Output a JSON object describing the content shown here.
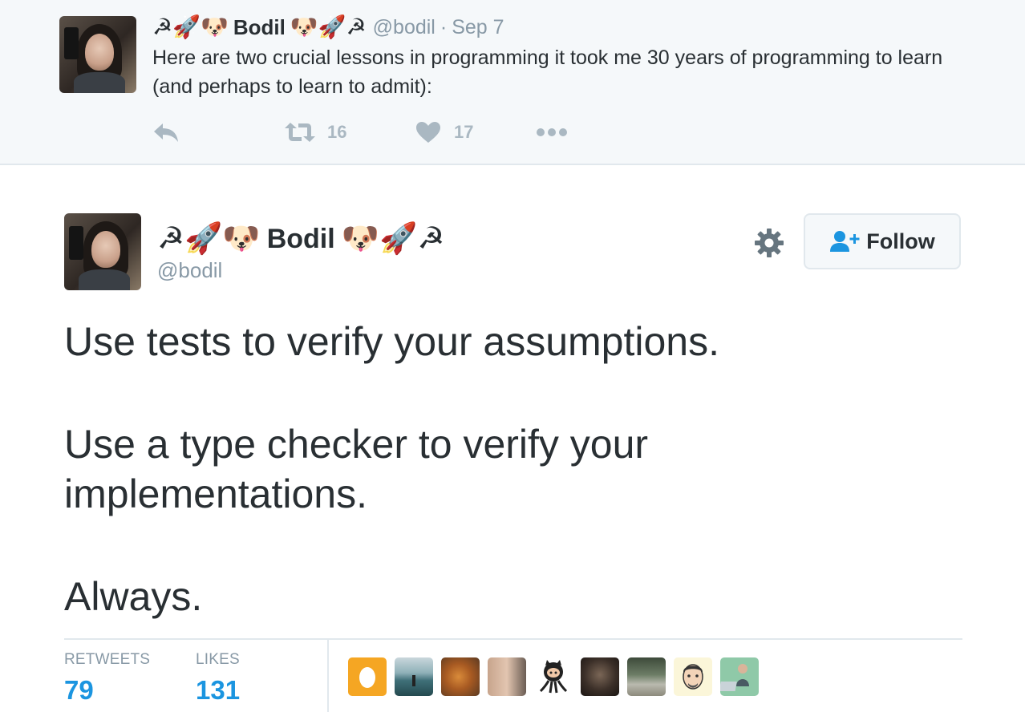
{
  "parent_tweet": {
    "display_name": "Bodil",
    "name_prefix_emoji": "☭🚀🐶",
    "name_suffix_emoji": "🐶🚀☭",
    "handle": "@bodil",
    "separator": "·",
    "date": "Sep 7",
    "text": "Here are two crucial lessons in programming it took me 30 years of programming to learn (and perhaps to learn to admit):",
    "retweet_count": "16",
    "like_count": "17",
    "icons": [
      "reply-icon",
      "retweet-icon",
      "heart-icon",
      "more-icon"
    ]
  },
  "tweet": {
    "display_name": "Bodil",
    "name_prefix_emoji": "☭🚀🐶",
    "name_suffix_emoji": "🐶🚀☭",
    "handle": "@bodil",
    "follow_label": "Follow",
    "paragraphs": [
      "Use tests to verify your assumptions.",
      "Use a type checker to verify your implementations.",
      "Always."
    ],
    "stats": {
      "retweets_label": "RETWEETS",
      "retweets_value": "79",
      "likes_label": "LIKES",
      "likes_value": "131"
    },
    "liker_avatars": [
      "egg",
      "lake",
      "food",
      "faces",
      "octocat",
      "bearded",
      "park",
      "cartoon",
      "laptop"
    ]
  },
  "colors": {
    "accent_blue": "#1b95e0",
    "muted_gray": "#8899a6",
    "icon_gray": "#aab8c2",
    "text_dark": "#292f33",
    "parent_bg": "#f5f8fa",
    "border": "#e1e8ed"
  }
}
